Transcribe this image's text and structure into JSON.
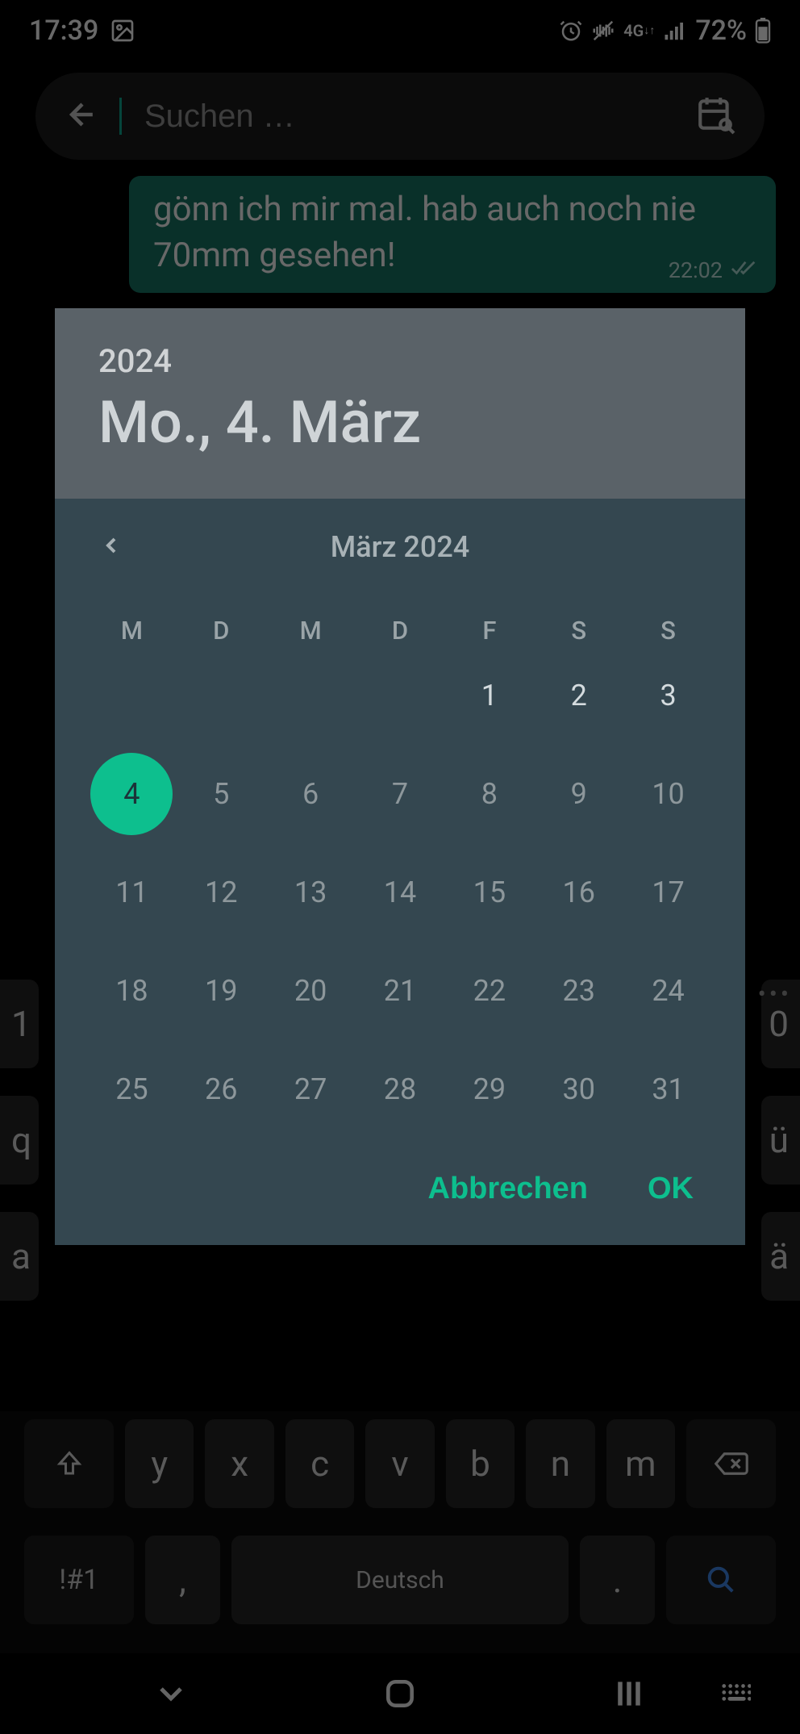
{
  "status": {
    "time": "17:39",
    "battery": "72%",
    "network": "4G"
  },
  "search": {
    "placeholder": "Suchen …"
  },
  "chat": {
    "message": "gönn ich mir mal. hab auch noch nie 70mm gesehen!",
    "time": "22:02"
  },
  "picker": {
    "year": "2024",
    "date_label": "Mo., 4. März",
    "month_label": "März 2024",
    "dow": [
      "M",
      "D",
      "M",
      "D",
      "F",
      "S",
      "S"
    ],
    "days": [
      {
        "n": "",
        "t": "empty"
      },
      {
        "n": "",
        "t": "empty"
      },
      {
        "n": "",
        "t": "empty"
      },
      {
        "n": "",
        "t": "empty"
      },
      {
        "n": "1",
        "t": "current"
      },
      {
        "n": "2",
        "t": "current"
      },
      {
        "n": "3",
        "t": "current"
      },
      {
        "n": "4",
        "t": "selected"
      },
      {
        "n": "5",
        "t": ""
      },
      {
        "n": "6",
        "t": ""
      },
      {
        "n": "7",
        "t": ""
      },
      {
        "n": "8",
        "t": ""
      },
      {
        "n": "9",
        "t": ""
      },
      {
        "n": "10",
        "t": ""
      },
      {
        "n": "11",
        "t": ""
      },
      {
        "n": "12",
        "t": ""
      },
      {
        "n": "13",
        "t": ""
      },
      {
        "n": "14",
        "t": ""
      },
      {
        "n": "15",
        "t": ""
      },
      {
        "n": "16",
        "t": ""
      },
      {
        "n": "17",
        "t": ""
      },
      {
        "n": "18",
        "t": ""
      },
      {
        "n": "19",
        "t": ""
      },
      {
        "n": "20",
        "t": ""
      },
      {
        "n": "21",
        "t": ""
      },
      {
        "n": "22",
        "t": ""
      },
      {
        "n": "23",
        "t": ""
      },
      {
        "n": "24",
        "t": ""
      },
      {
        "n": "25",
        "t": ""
      },
      {
        "n": "26",
        "t": ""
      },
      {
        "n": "27",
        "t": ""
      },
      {
        "n": "28",
        "t": ""
      },
      {
        "n": "29",
        "t": ""
      },
      {
        "n": "30",
        "t": ""
      },
      {
        "n": "31",
        "t": ""
      }
    ],
    "cancel": "Abbrechen",
    "ok": "OK"
  },
  "keyboard": {
    "row3": [
      "y",
      "x",
      "c",
      "v",
      "b",
      "n",
      "m"
    ],
    "symbols": "!#1",
    "comma": ",",
    "space": "Deutsch",
    "period": ".",
    "partial_q": "q",
    "partial_a": "a",
    "partial_1": "1",
    "partial_ue": "ü",
    "partial_ae": "ä",
    "partial_0": "0"
  }
}
